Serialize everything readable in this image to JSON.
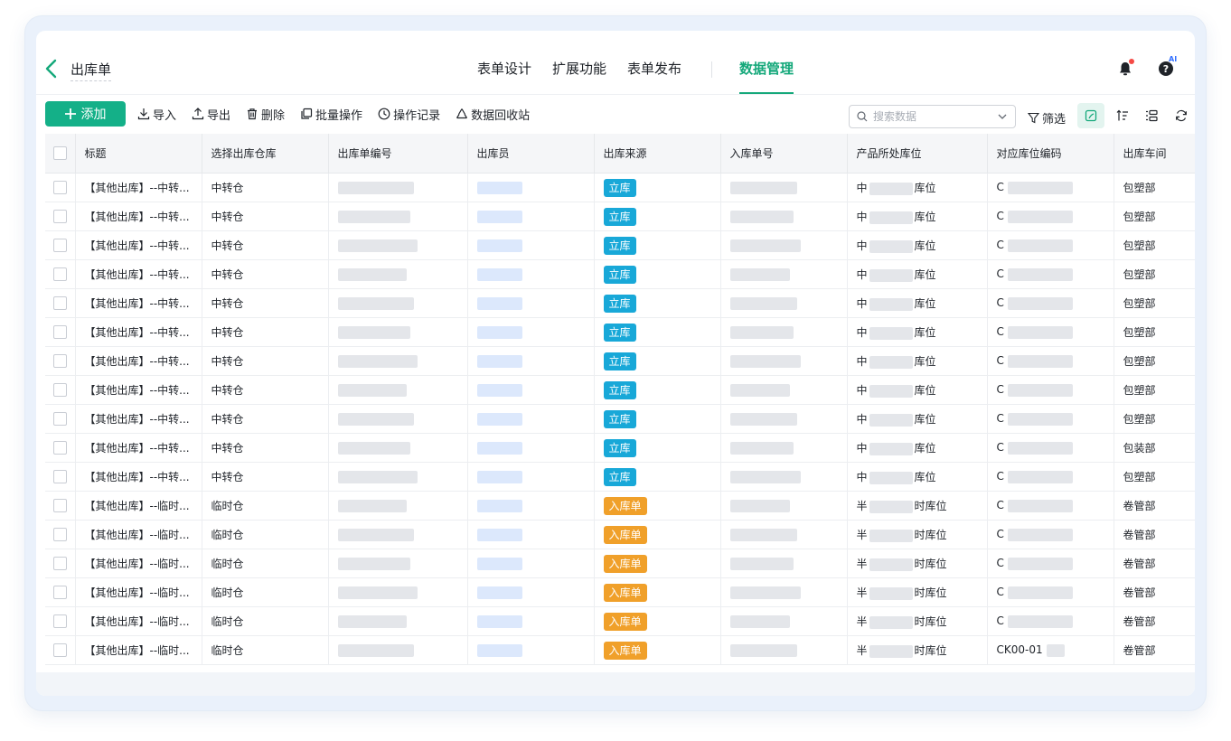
{
  "header": {
    "title": "出库单",
    "tabs": [
      {
        "label": "表单设计"
      },
      {
        "label": "扩展功能"
      },
      {
        "label": "表单发布"
      },
      {
        "label": "数据管理",
        "active": true
      }
    ],
    "ai_badge": "AI"
  },
  "toolbar": {
    "add_label": "添加",
    "tools": [
      "导入",
      "导出",
      "删除",
      "批量操作",
      "操作记录",
      "数据回收站"
    ],
    "search_placeholder": "搜索数据",
    "filter_label": "筛选"
  },
  "colors": {
    "accent": "#14b088",
    "tag_blue": "#18a8d8",
    "tag_orange": "#f0a02a"
  },
  "table": {
    "columns": [
      "标题",
      "选择出库仓库",
      "出库单编号",
      "出库员",
      "出库来源",
      "入库单号",
      "产品所处库位",
      "对应库位编码",
      "出库车间"
    ],
    "rows": [
      {
        "title": "【其他出库】--中转...",
        "warehouse": "中转仓",
        "source": "立库",
        "source_color": "blue",
        "location": "中",
        "location_suffix": "库位",
        "code": "C",
        "workshop": "包塑部"
      },
      {
        "title": "【其他出库】--中转...",
        "warehouse": "中转仓",
        "source": "立库",
        "source_color": "blue",
        "location": "中",
        "location_suffix": "库位",
        "code": "C",
        "workshop": "包塑部"
      },
      {
        "title": "【其他出库】--中转...",
        "warehouse": "中转仓",
        "source": "立库",
        "source_color": "blue",
        "location": "中",
        "location_suffix": "库位",
        "code": "C",
        "workshop": "包塑部"
      },
      {
        "title": "【其他出库】--中转...",
        "warehouse": "中转仓",
        "source": "立库",
        "source_color": "blue",
        "location": "中",
        "location_suffix": "库位",
        "code": "C",
        "workshop": "包塑部"
      },
      {
        "title": "【其他出库】--中转...",
        "warehouse": "中转仓",
        "source": "立库",
        "source_color": "blue",
        "location": "中",
        "location_suffix": "库位",
        "code": "C",
        "workshop": "包塑部"
      },
      {
        "title": "【其他出库】--中转...",
        "warehouse": "中转仓",
        "source": "立库",
        "source_color": "blue",
        "location": "中",
        "location_suffix": "库位",
        "code": "C",
        "workshop": "包塑部"
      },
      {
        "title": "【其他出库】--中转...",
        "warehouse": "中转仓",
        "source": "立库",
        "source_color": "blue",
        "location": "中",
        "location_suffix": "库位",
        "code": "C",
        "workshop": "包塑部"
      },
      {
        "title": "【其他出库】--中转...",
        "warehouse": "中转仓",
        "source": "立库",
        "source_color": "blue",
        "location": "中",
        "location_suffix": "库位",
        "code": "C",
        "workshop": "包塑部"
      },
      {
        "title": "【其他出库】--中转...",
        "warehouse": "中转仓",
        "source": "立库",
        "source_color": "blue",
        "location": "中",
        "location_suffix": "库位",
        "code": "C",
        "workshop": "包塑部"
      },
      {
        "title": "【其他出库】--中转...",
        "warehouse": "中转仓",
        "source": "立库",
        "source_color": "blue",
        "location": "中",
        "location_suffix": "库位",
        "code": "C",
        "workshop": "包装部"
      },
      {
        "title": "【其他出库】--中转...",
        "warehouse": "中转仓",
        "source": "立库",
        "source_color": "blue",
        "location": "中",
        "location_suffix": "库位",
        "code": "C",
        "workshop": "包塑部"
      },
      {
        "title": "【其他出库】--临时...",
        "warehouse": "临时仓",
        "source": "入库单",
        "source_color": "orange",
        "location": "半",
        "location_suffix": "时库位",
        "code": "C",
        "workshop": "卷管部"
      },
      {
        "title": "【其他出库】--临时...",
        "warehouse": "临时仓",
        "source": "入库单",
        "source_color": "orange",
        "location": "半",
        "location_suffix": "时库位",
        "code": "C",
        "workshop": "卷管部"
      },
      {
        "title": "【其他出库】--临时...",
        "warehouse": "临时仓",
        "source": "入库单",
        "source_color": "orange",
        "location": "半",
        "location_suffix": "时库位",
        "code": "C",
        "workshop": "卷管部"
      },
      {
        "title": "【其他出库】--临时...",
        "warehouse": "临时仓",
        "source": "入库单",
        "source_color": "orange",
        "location": "半",
        "location_suffix": "时库位",
        "code": "C",
        "workshop": "卷管部"
      },
      {
        "title": "【其他出库】--临时...",
        "warehouse": "临时仓",
        "source": "入库单",
        "source_color": "orange",
        "location": "半",
        "location_suffix": "时库位",
        "code": "C",
        "workshop": "卷管部"
      },
      {
        "title": "【其他出库】--临时...",
        "warehouse": "临时仓",
        "source": "入库单",
        "source_color": "orange",
        "location": "半",
        "location_suffix": "时库位",
        "code": "CK00-01",
        "workshop": "卷管部"
      }
    ]
  }
}
